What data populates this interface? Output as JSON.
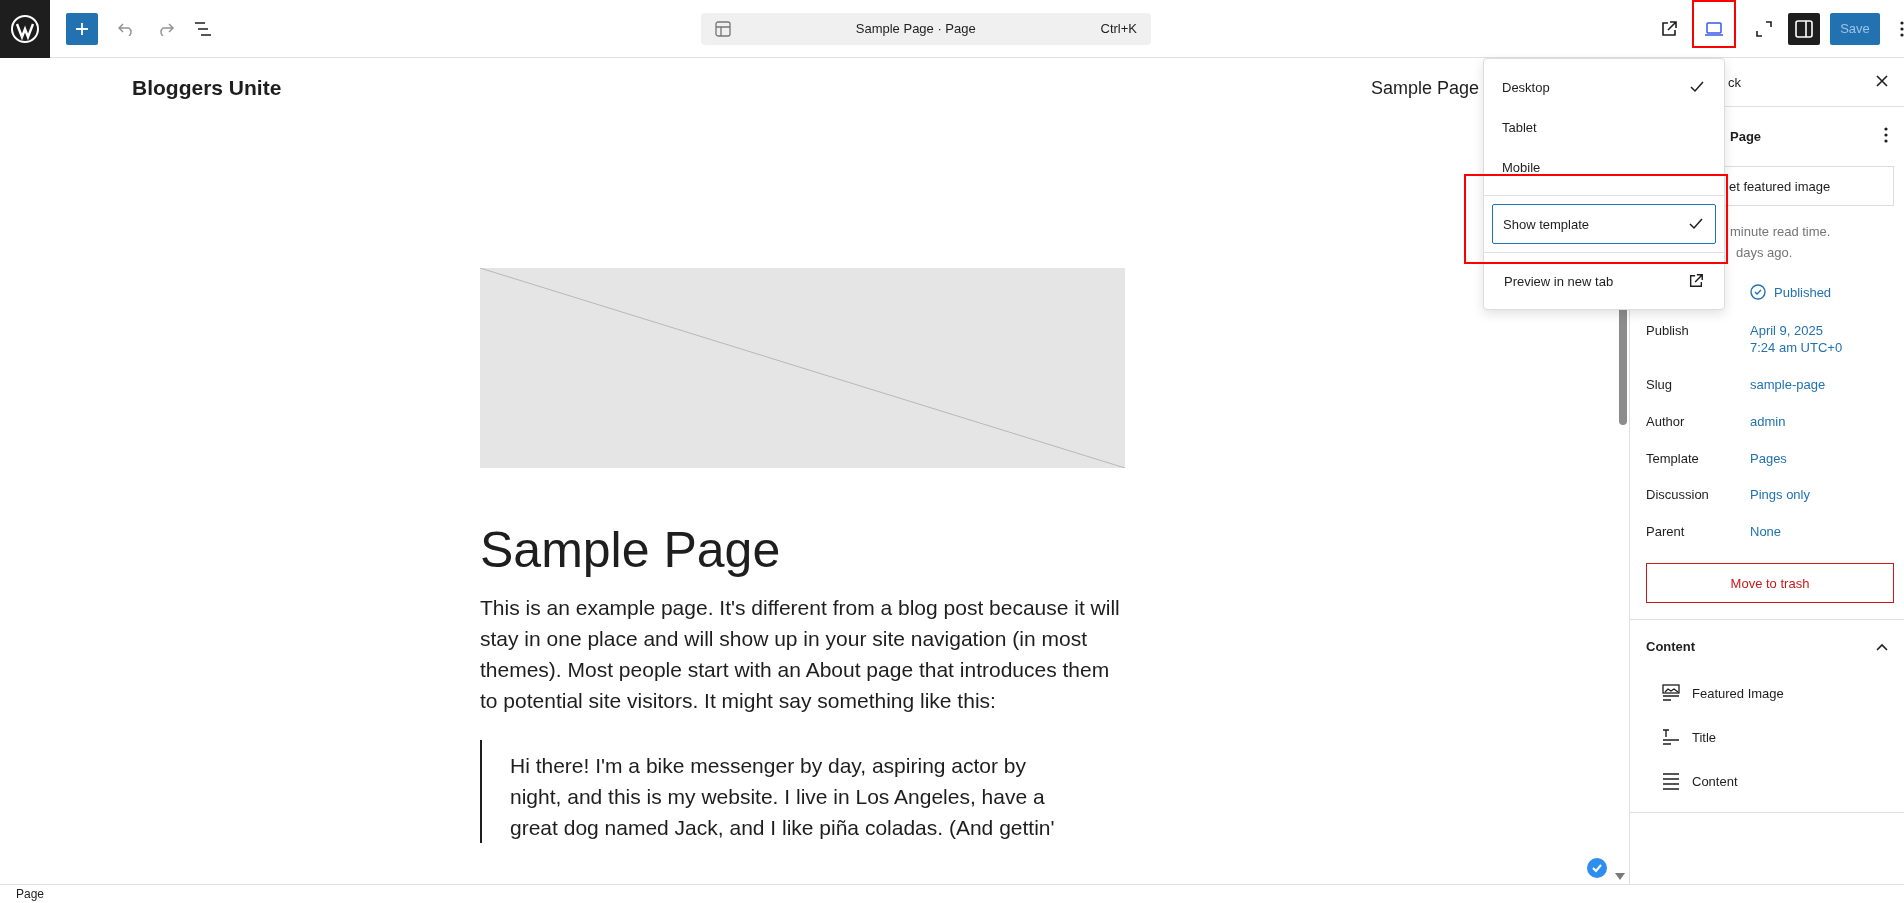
{
  "toolbar": {
    "command_bar": {
      "title": "Sample Page · Page",
      "shortcut": "Ctrl+K"
    },
    "device_button": {
      "highlighted": true
    },
    "save": {
      "label": "Save",
      "disabled": true
    }
  },
  "device_menu": {
    "devices": [
      {
        "label": "Desktop",
        "checked": true
      },
      {
        "label": "Tablet",
        "checked": false
      },
      {
        "label": "Mobile",
        "checked": false
      }
    ],
    "show_template": {
      "label": "Show template",
      "checked": true,
      "highlighted": true
    },
    "preview": {
      "label": "Preview in new tab"
    }
  },
  "site": {
    "title": "Bloggers Unite",
    "nav": [
      "Sample Page"
    ]
  },
  "page": {
    "title": "Sample Page",
    "paragraph": "This is an example page. It's different from a blog post because it will stay in one place and will show up in your site navigation (in most themes). Most people start with an About page that introduces them to potential site visitors. It might say something like this:",
    "quote": "Hi there! I'm a bike messenger by day, aspiring actor by night, and this is my website. I live in Los Angeles, have a great dog named Jack, and I like piña coladas. (And gettin'"
  },
  "sidebar": {
    "tab_fragment": "ck",
    "heading_fragment": "Page",
    "featured_button": "et featured image",
    "meta": [
      "minute read time.",
      "days ago."
    ],
    "status": "Published",
    "fields": [
      {
        "label": "Publish",
        "value": "April 9, 2025\n7:24 am UTC+0"
      },
      {
        "label": "Slug",
        "value": "sample-page"
      },
      {
        "label": "Author",
        "value": "admin"
      },
      {
        "label": "Template",
        "value": "Pages"
      },
      {
        "label": "Discussion",
        "value": "Pings only"
      },
      {
        "label": "Parent",
        "value": "None"
      }
    ],
    "trash": "Move to trash",
    "content_section": {
      "title": "Content",
      "expanded": true,
      "items": [
        {
          "kind": "image",
          "label": "Featured Image"
        },
        {
          "kind": "title",
          "label": "Title"
        },
        {
          "kind": "content",
          "label": "Content"
        }
      ]
    }
  },
  "status_bar": {
    "breadcrumb": "Page"
  }
}
